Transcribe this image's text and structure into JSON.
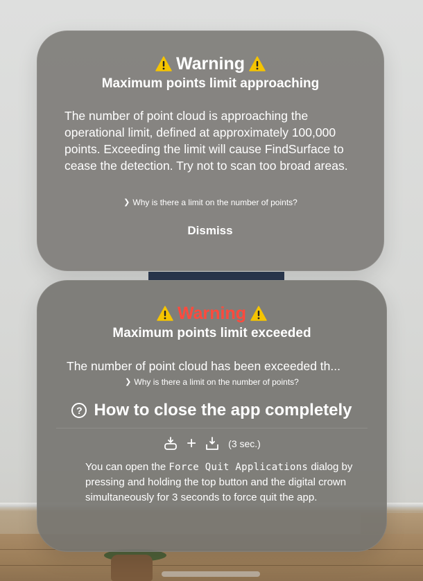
{
  "alert_approaching": {
    "warning_label": "Warning",
    "subtitle": "Maximum points limit approaching",
    "body": "The number of point cloud is approaching the operational limit, defined at approximately 100,000 points. Exceeding the limit will cause FindSurface to cease the detection. Try not to scan too broad areas.",
    "link_label": "Why is there a limit on the number of points?",
    "dismiss_label": "Dismiss"
  },
  "alert_exceeded": {
    "warning_label": "Warning",
    "warning_color": "#ff4a3d",
    "subtitle": "Maximum points limit exceeded",
    "body": "The number of point cloud has been exceeded th...",
    "link_label": "Why is there a limit on the number of points?",
    "howto_title": "How to close the app completely",
    "howto_icon": "question-circle-icon",
    "button_combo": {
      "left_icon": "top-button-icon",
      "plus": "+",
      "right_icon": "digital-crown-icon",
      "duration": "(3 sec.)"
    },
    "desc_before": "You can open the ",
    "desc_mono": "Force Quit Applications",
    "desc_after": " dialog by pressing and holding the top button and the digital crown simultaneously for 3 seconds to force quit the app."
  },
  "icons": {
    "warning": "warning-triangle-icon",
    "chevron": "chevron-right-icon"
  },
  "colors": {
    "panel_bg": "#787672",
    "text": "#ffffff",
    "warning_triangle": "#f5c400"
  }
}
